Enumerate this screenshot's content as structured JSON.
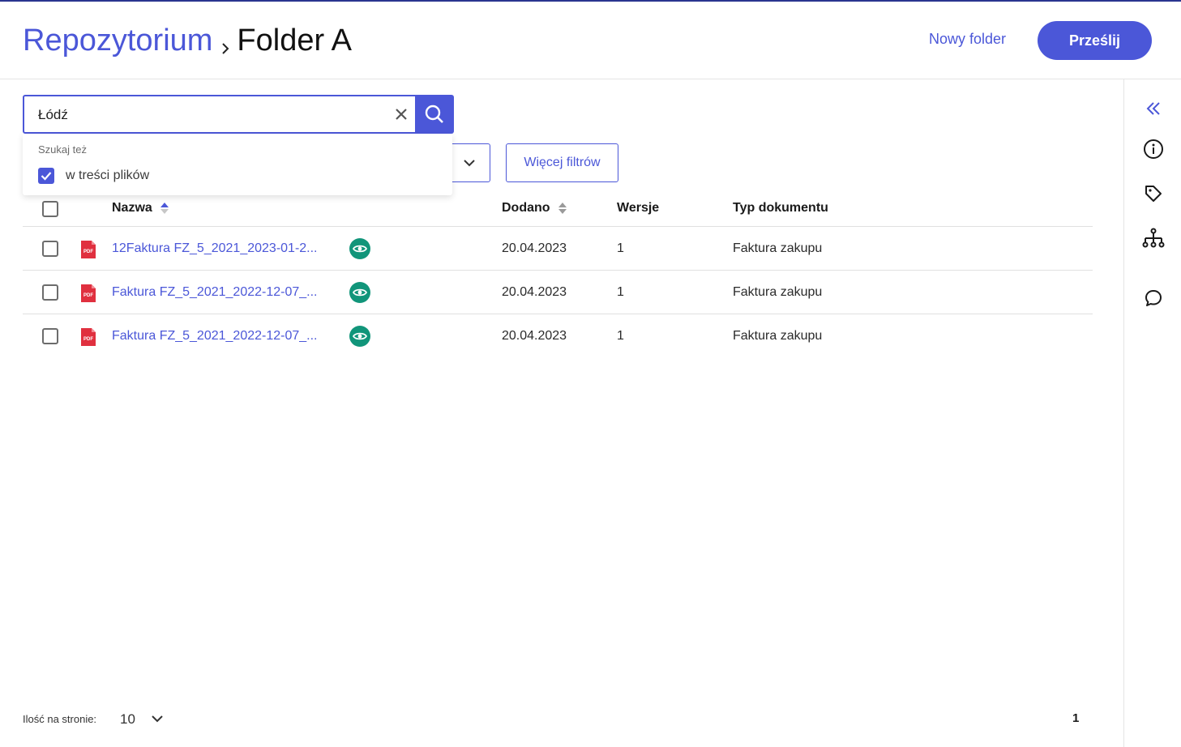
{
  "header": {
    "breadcrumb_root": "Repozytorium",
    "breadcrumb_current": "Folder A",
    "new_folder_label": "Nowy folder",
    "upload_label": "Prześlij"
  },
  "search": {
    "value": "Łódź",
    "dropdown_hint": "Szukaj też",
    "option_label": "w treści plików",
    "option_checked": true
  },
  "filters": {
    "more_filters_label": "Więcej filtrów"
  },
  "table": {
    "columns": {
      "name": "Nazwa",
      "added": "Dodano",
      "versions": "Wersje",
      "doc_type": "Typ dokumentu"
    },
    "rows": [
      {
        "name": "12Faktura FZ_5_2021_2023-01-2...",
        "added": "20.04.2023",
        "versions": "1",
        "doc_type": "Faktura zakupu"
      },
      {
        "name": "Faktura FZ_5_2021_2022-12-07_...",
        "added": "20.04.2023",
        "versions": "1",
        "doc_type": "Faktura zakupu"
      },
      {
        "name": "Faktura FZ_5_2021_2022-12-07_...",
        "added": "20.04.2023",
        "versions": "1",
        "doc_type": "Faktura zakupu"
      }
    ]
  },
  "footer": {
    "page_size_label": "Ilość na stronie:",
    "page_size": "10",
    "current_page": "1"
  },
  "icons": {
    "rail": [
      "collapse-icon",
      "info-icon",
      "tag-icon",
      "hierarchy-icon",
      "comment-icon"
    ],
    "file": "pdf-icon",
    "preview": "eye-icon"
  },
  "colors": {
    "accent": "#4b57d8",
    "preview": "#11957a",
    "pdf": "#e0303f",
    "top_border": "#2a3590"
  }
}
